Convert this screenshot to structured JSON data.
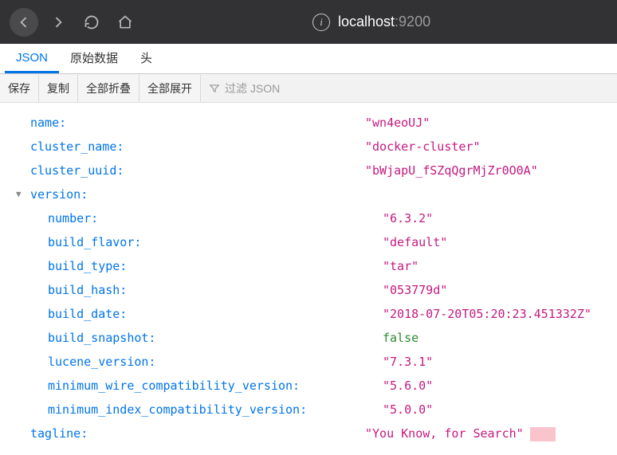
{
  "url": {
    "host": "localhost",
    "port": ":9200"
  },
  "tabs": {
    "json": "JSON",
    "raw": "原始数据",
    "headers": "头"
  },
  "toolbar": {
    "save": "保存",
    "copy": "复制",
    "collapse_all": "全部折叠",
    "expand_all": "全部展开",
    "filter_placeholder": "过滤 JSON"
  },
  "json": {
    "name_key": "name:",
    "name_val": "\"wn4eoUJ\"",
    "cluster_name_key": "cluster_name:",
    "cluster_name_val": "\"docker-cluster\"",
    "cluster_uuid_key": "cluster_uuid:",
    "cluster_uuid_val": "\"bWjapU_fSZqQgrMjZr0O0A\"",
    "version_key": "version:",
    "number_key": "number:",
    "number_val": "\"6.3.2\"",
    "build_flavor_key": "build_flavor:",
    "build_flavor_val": "\"default\"",
    "build_type_key": "build_type:",
    "build_type_val": "\"tar\"",
    "build_hash_key": "build_hash:",
    "build_hash_val": "\"053779d\"",
    "build_date_key": "build_date:",
    "build_date_val": "\"2018-07-20T05:20:23.451332Z\"",
    "build_snapshot_key": "build_snapshot:",
    "build_snapshot_val": "false",
    "lucene_version_key": "lucene_version:",
    "lucene_version_val": "\"7.3.1\"",
    "min_wire_key": "minimum_wire_compatibility_version:",
    "min_wire_val": "\"5.6.0\"",
    "min_index_key": "minimum_index_compatibility_version:",
    "min_index_val": "\"5.0.0\"",
    "tagline_key": "tagline:",
    "tagline_val": "\"You Know, for Search\""
  }
}
